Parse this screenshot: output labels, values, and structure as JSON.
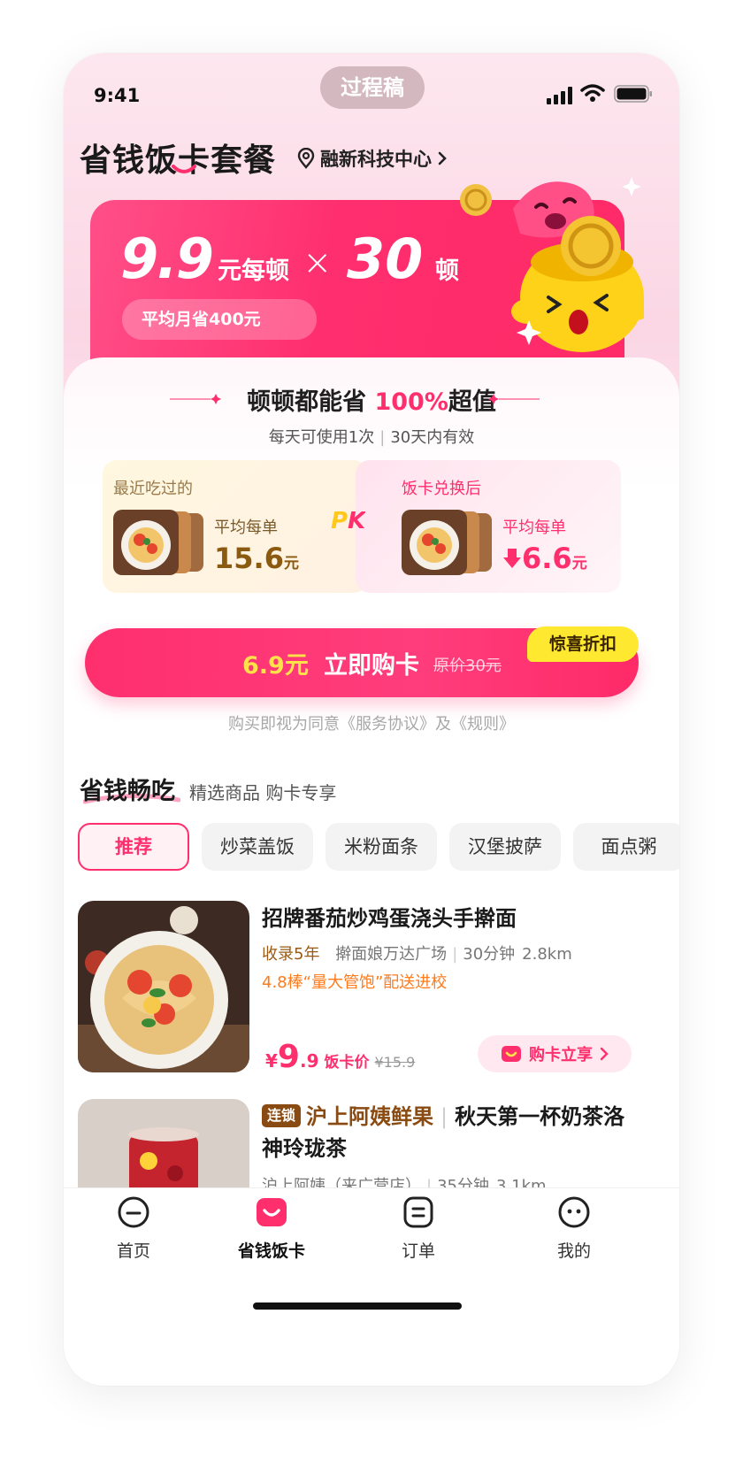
{
  "status": {
    "time": "9:41",
    "badge": "过程稿"
  },
  "header": {
    "title": "省钱饭卡套餐",
    "location": "融新科技中心"
  },
  "banner": {
    "price": "9.9",
    "price_unit": "元每顿",
    "times_sign": "×",
    "count": "30",
    "count_unit": "顿",
    "saving": "平均月省400元"
  },
  "value": {
    "headline_prefix": "顿顿都能省",
    "headline_accent": "100%",
    "headline_suffix": "超值",
    "sub_a": "每天可使用1次",
    "sub_b": "30天内有效"
  },
  "compare": {
    "left_label": "最近吃过的",
    "left_meta": "平均每单",
    "left_price": "15.6",
    "left_unit": "元",
    "right_label": "饭卡兑换后",
    "right_meta": "平均每单",
    "right_price": "6.6",
    "right_unit": "元",
    "vs": "PK"
  },
  "buy": {
    "price": "6.9元",
    "label": "立即购卡",
    "original": "原价30元",
    "tag": "惊喜折扣",
    "agreement": "购买即视为同意《服务协议》及《规则》"
  },
  "section": {
    "title": "省钱畅吃",
    "subtitle": "精选商品 购卡专享",
    "tabs": [
      "推荐",
      "炒菜盖饭",
      "米粉面条",
      "汉堡披萨",
      "面点粥"
    ]
  },
  "products": [
    {
      "title": "招牌番茄炒鸡蛋浇头手擀面",
      "years": "收录5年",
      "shop": "擀面娘万达广场",
      "time": "30分钟",
      "distance": "2.8km",
      "tag": "4.8棒“量大管饱”配送进校",
      "currency": "¥",
      "price_int": "9",
      "price_dec": ".9",
      "price_label": "饭卡价",
      "orig_price": "¥15.9",
      "button": "购卡立享"
    },
    {
      "badge": "连锁",
      "shop_name": "沪上阿姨鲜果",
      "title": "秋天第一杯奶茶洛神玲珑茶",
      "meta": "沪上阿姨（来广营店）",
      "time": "35分钟",
      "distance": "3.1km"
    }
  ],
  "tabbar": {
    "items": [
      "首页",
      "省钱饭卡",
      "订单",
      "我的"
    ],
    "active": 1
  },
  "colors": {
    "accent": "#ff2f6e",
    "yellow": "#ffe14a",
    "brown": "#8a4b12"
  }
}
